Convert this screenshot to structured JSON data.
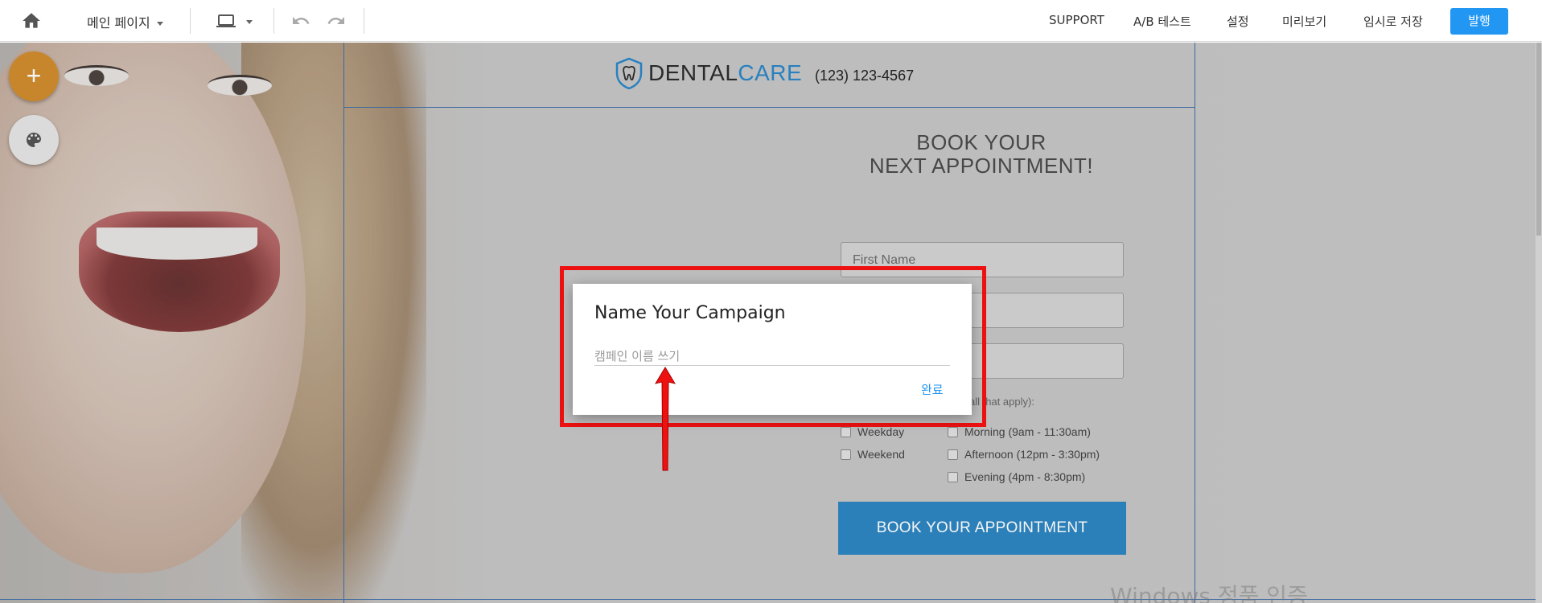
{
  "toolbar": {
    "page_selector": "메인 페이지",
    "links": {
      "support": "SUPPORT",
      "ab_test": "A/B 테스트",
      "settings": "설정",
      "preview": "미리보기",
      "save_draft": "임시로 저장"
    },
    "publish": "발행"
  },
  "fab": {
    "add_symbol": "+"
  },
  "landing": {
    "brand_dental": "DENTAL",
    "brand_care": "CARE",
    "phone": "(123) 123-4567",
    "title_line1": "BOOK YOUR",
    "title_line2": "NEXT APPOINTMENT!",
    "field_first_name": "First Name",
    "hint_partial": "all that apply):",
    "checkboxes": {
      "weekday": "Weekday",
      "weekend": "Weekend",
      "morning": "Morning (9am - 11:30am)",
      "afternoon": "Afternoon (12pm - 3:30pm)",
      "evening": "Evening (4pm - 8:30pm)"
    },
    "book_button": "BOOK YOUR APPOINTMENT"
  },
  "dialog": {
    "title": "Name Your Campaign",
    "input_placeholder": "캠페인 이름 쓰기",
    "input_value": "",
    "confirm": "완료"
  },
  "watermark": "Windows 정품 인증",
  "colors": {
    "publish_bg": "#2196f3",
    "fab_add": "#d18c2e",
    "brand_blue": "#2a86c8",
    "book_button": "#2e86c1",
    "highlight_red": "#e11111"
  },
  "icons": [
    "home-icon",
    "laptop-icon",
    "undo-icon",
    "redo-icon",
    "plus-icon",
    "palette-icon",
    "tooth-icon",
    "arrow-up-icon"
  ]
}
